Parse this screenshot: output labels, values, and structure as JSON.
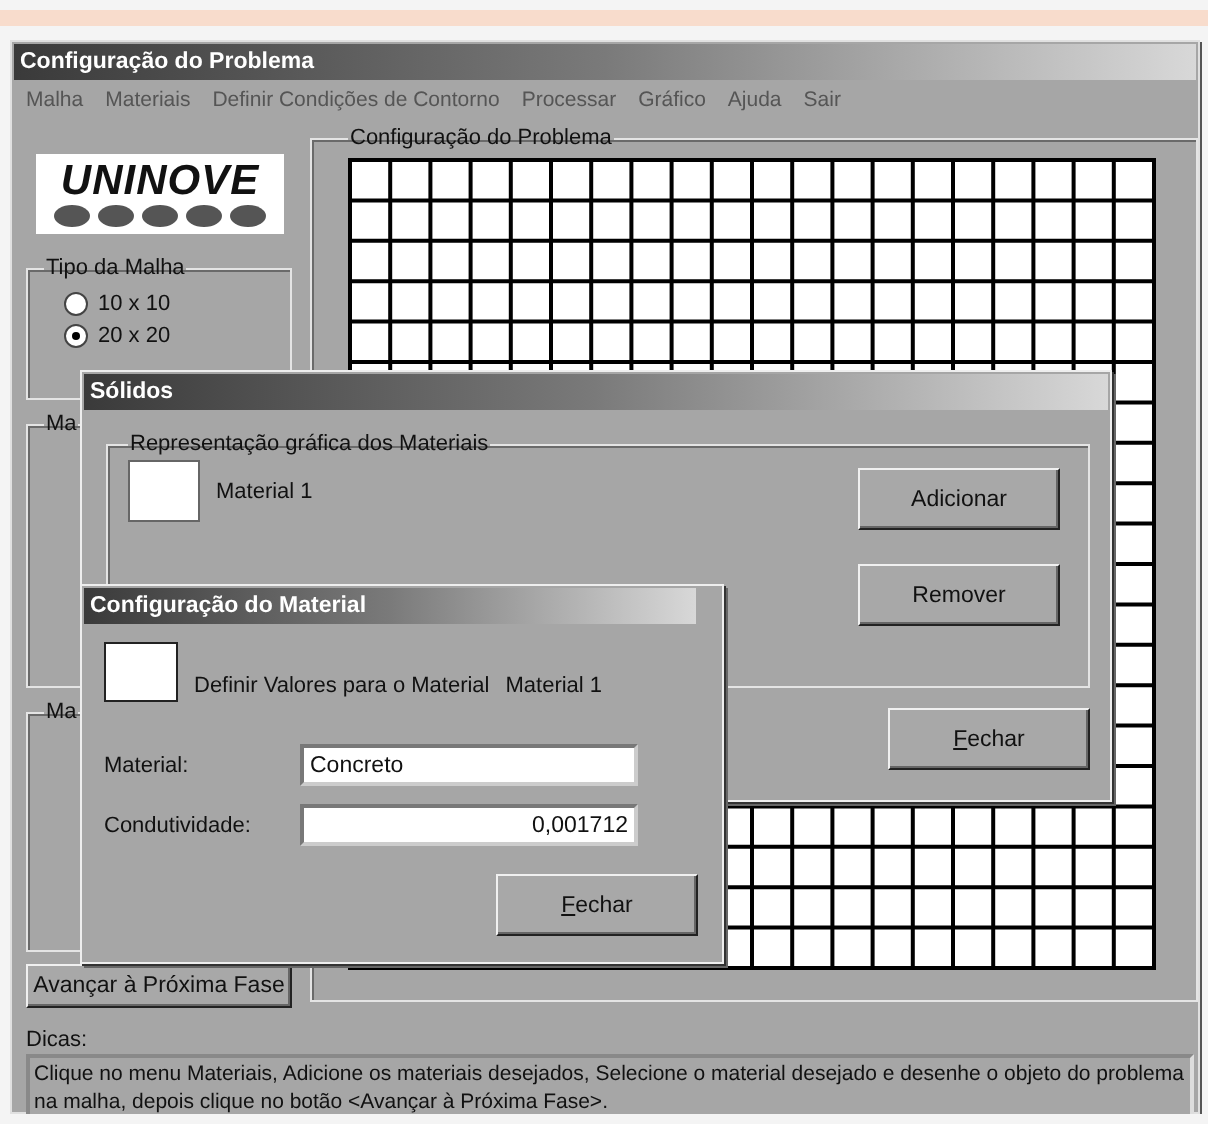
{
  "window": {
    "title": "Configuração do Problema"
  },
  "menu": [
    {
      "label": "Malha"
    },
    {
      "label": "Materiais"
    },
    {
      "label": "Definir Condições de Contorno"
    },
    {
      "label": "Processar"
    },
    {
      "label": "Gráfico"
    },
    {
      "label": "Ajuda"
    },
    {
      "label": "Sair"
    }
  ],
  "logo": {
    "text": "UNINOVE"
  },
  "mesh_type": {
    "title": "Tipo da Malha",
    "options": [
      {
        "label": "10 x 10",
        "selected": false
      },
      {
        "label": "20 x 20",
        "selected": true
      }
    ]
  },
  "side_groups": [
    {
      "title": "Ma"
    },
    {
      "title": "Ma"
    }
  ],
  "problem_panel": {
    "title": "Configuração do Problema"
  },
  "advance_button": {
    "label": "Avançar à Próxima Fase"
  },
  "tips": {
    "label": "Dicas:",
    "text": "Clique no menu Materiais, Adicione os materiais desejados, Selecione o material desejado e desenhe o objeto do problema na malha, depois clique no botão <Avançar à Próxima Fase>."
  },
  "solids_dialog": {
    "title": "Sólidos",
    "group_title": "Representação gráfica dos Materiais",
    "materials": [
      {
        "name": "Material 1",
        "color": "#ffffff"
      }
    ],
    "buttons": [
      {
        "label": "Adicionar",
        "mnemonic": false
      },
      {
        "label": "Remover",
        "mnemonic": false
      }
    ],
    "close_button": {
      "label": "Fechar",
      "mnemonic": true
    }
  },
  "material_dialog": {
    "title": "Configuração do Material",
    "prompt": "Definir Valores para o Material",
    "material_name": "Material 1",
    "fields": [
      {
        "label": "Material:",
        "value": "Concreto",
        "kind": "text"
      },
      {
        "label": "Condutividade:",
        "value": "0,001712",
        "kind": "number"
      }
    ],
    "close_button": {
      "label": "Fechar",
      "mnemonic": true
    }
  }
}
